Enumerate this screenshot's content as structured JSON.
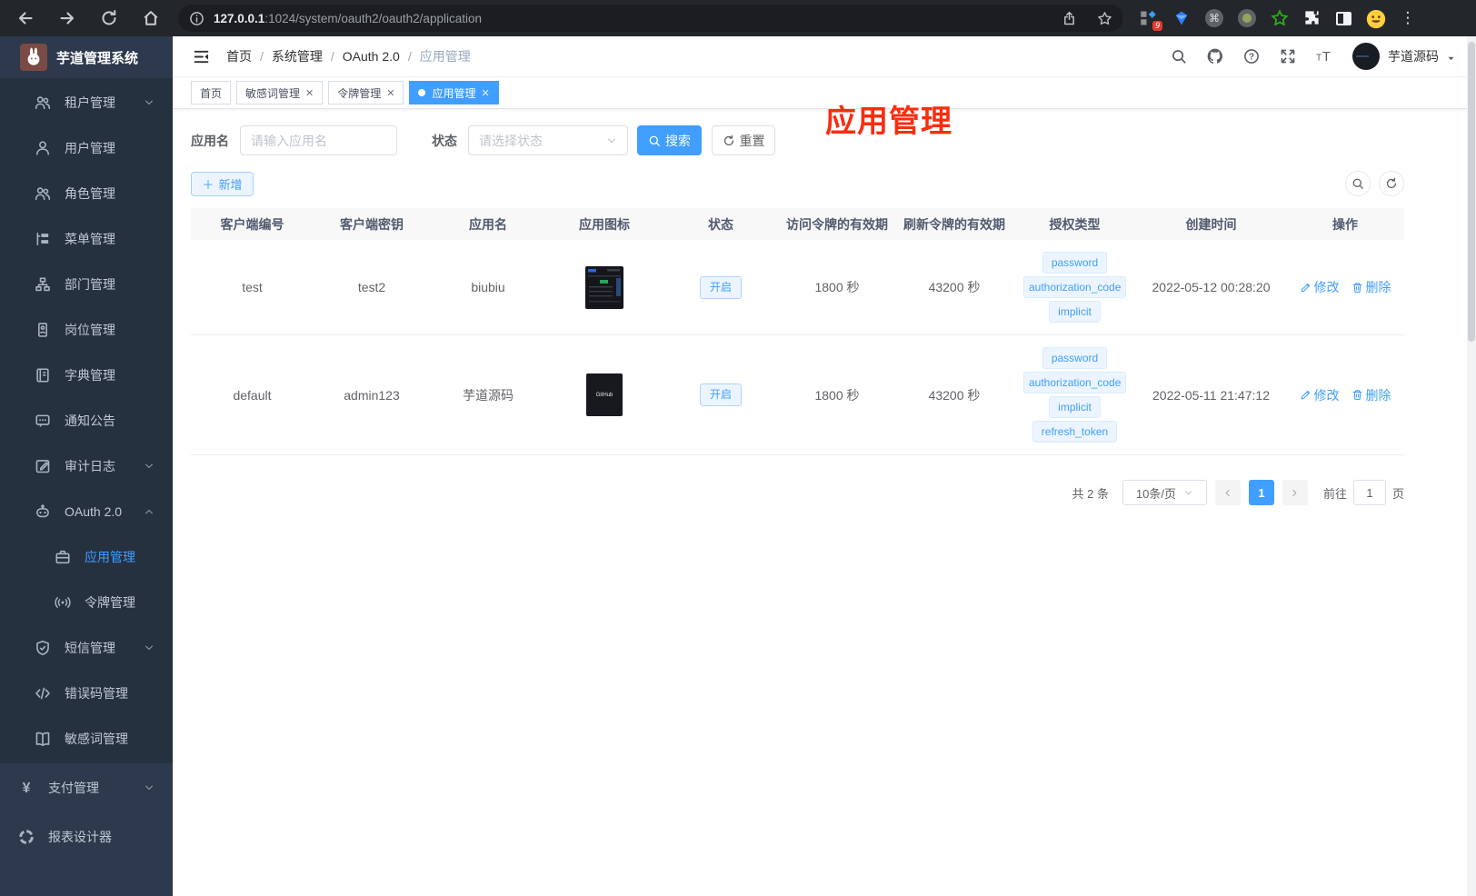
{
  "browser": {
    "url_host": "127.0.0.1",
    "url_rest": ":1024/system/oauth2/oauth2/application",
    "extension_badge": "9"
  },
  "sidebar": {
    "logo_title": "芋道管理系统",
    "items": [
      {
        "label": "租户管理",
        "icon": "users-icon",
        "arrow": "down"
      },
      {
        "label": "用户管理",
        "icon": "user-icon"
      },
      {
        "label": "角色管理",
        "icon": "users-icon"
      },
      {
        "label": "菜单管理",
        "icon": "menu-tree-icon"
      },
      {
        "label": "部门管理",
        "icon": "org-chart-icon"
      },
      {
        "label": "岗位管理",
        "icon": "badge-icon"
      },
      {
        "label": "字典管理",
        "icon": "dictionary-icon"
      },
      {
        "label": "通知公告",
        "icon": "announcement-icon"
      },
      {
        "label": "审计日志",
        "icon": "audit-log-icon",
        "arrow": "down"
      },
      {
        "label": "OAuth 2.0",
        "icon": "robot-icon",
        "arrow": "up"
      },
      {
        "label": "应用管理",
        "icon": "briefcase-icon",
        "sub": true,
        "active": true
      },
      {
        "label": "令牌管理",
        "icon": "token-signal-icon",
        "sub": true
      },
      {
        "label": "短信管理",
        "icon": "shield-check-icon",
        "arrow": "down"
      },
      {
        "label": "错误码管理",
        "icon": "code-icon"
      },
      {
        "label": "敏感词管理",
        "icon": "open-book-icon"
      }
    ],
    "bottom_items": [
      {
        "label": "支付管理",
        "icon": "yen-icon",
        "arrow": "down"
      },
      {
        "label": "报表设计器",
        "icon": "report-icon"
      }
    ]
  },
  "header": {
    "breadcrumb": [
      "首页",
      "系统管理",
      "OAuth 2.0",
      "应用管理"
    ],
    "username": "芋道源码"
  },
  "tabs": [
    {
      "label": "首页",
      "closable": false
    },
    {
      "label": "敏感词管理",
      "closable": true
    },
    {
      "label": "令牌管理",
      "closable": true
    },
    {
      "label": "应用管理",
      "closable": true,
      "active": true
    }
  ],
  "annotation": {
    "text": "应用管理",
    "color": "#f92d10"
  },
  "filters": {
    "app_name_label": "应用名",
    "app_name_placeholder": "请输入应用名",
    "status_label": "状态",
    "status_placeholder": "请选择状态",
    "search_label": "搜索",
    "reset_label": "重置",
    "add_label": "新增"
  },
  "table": {
    "headers": [
      "客户端编号",
      "客户端密钥",
      "应用名",
      "应用图标",
      "状态",
      "访问令牌的有效期",
      "刷新令牌的有效期",
      "授权类型",
      "创建时间",
      "操作"
    ],
    "rows": [
      {
        "client_id": "test",
        "secret": "test2",
        "name": "biubiu",
        "status": "开启",
        "access_ttl": "1800 秒",
        "refresh_ttl": "43200 秒",
        "grants": [
          "password",
          "authorization_code",
          "implicit"
        ],
        "created": "2022-05-12 00:28:20",
        "edit": "修改",
        "delete": "删除"
      },
      {
        "client_id": "default",
        "secret": "admin123",
        "name": "芋道源码",
        "icon_label": "GitHub",
        "status": "开启",
        "access_ttl": "1800 秒",
        "refresh_ttl": "43200 秒",
        "grants": [
          "password",
          "authorization_code",
          "implicit",
          "refresh_token"
        ],
        "created": "2022-05-11 21:47:12",
        "edit": "修改",
        "delete": "删除"
      }
    ]
  },
  "pagination": {
    "total": "共 2 条",
    "page_size": "10条/页",
    "current_page": "1",
    "goto_label": "前往",
    "goto_value": "1",
    "page_unit": "页"
  }
}
